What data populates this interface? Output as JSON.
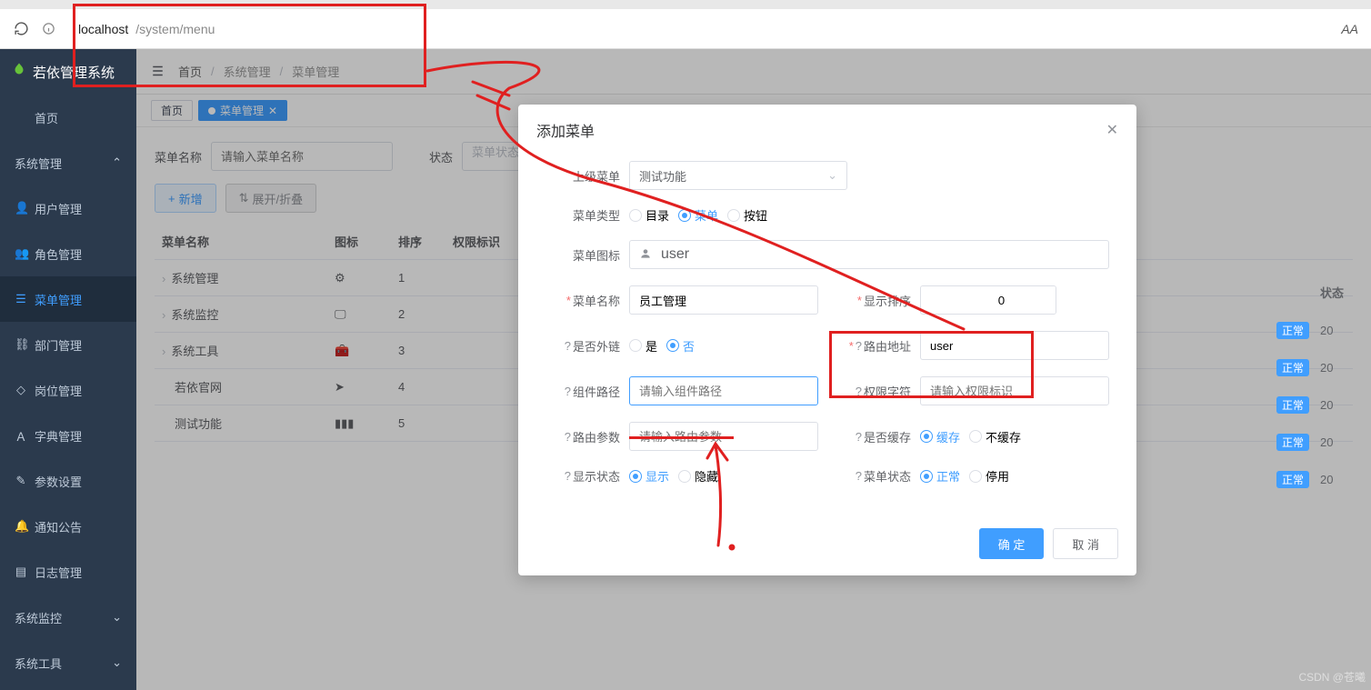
{
  "browser": {
    "tabs": [
      "若依管理系统",
      "若依管理系统"
    ],
    "url_origin": "localhost",
    "url_path": "/system/menu",
    "reader_label": "AA"
  },
  "app_title": "若依管理系统",
  "breadcrumbs": {
    "home": "首页",
    "sys": "系统管理",
    "menu": "菜单管理"
  },
  "tabs": {
    "home": "首页",
    "active": "菜单管理"
  },
  "sidebar": {
    "group_system": "系统管理",
    "group_monitor": "系统监控",
    "group_tool": "系统工具",
    "home": "首页",
    "items": [
      "用户管理",
      "角色管理",
      "菜单管理",
      "部门管理",
      "岗位管理",
      "字典管理",
      "参数设置",
      "通知公告",
      "日志管理"
    ]
  },
  "filter": {
    "name_label": "菜单名称",
    "name_placeholder": "请输入菜单名称",
    "status_label": "状态",
    "status_placeholder": "菜单状态"
  },
  "buttons": {
    "add": "新增",
    "expand": "展开/折叠"
  },
  "table": {
    "headers": [
      "菜单名称",
      "图标",
      "排序",
      "权限标识",
      "状态"
    ],
    "rows": [
      {
        "name": "系统管理",
        "order": "1",
        "status": "正常",
        "year": "20"
      },
      {
        "name": "系统监控",
        "order": "2",
        "status": "正常",
        "year": "20"
      },
      {
        "name": "系统工具",
        "order": "3",
        "status": "正常",
        "year": "20"
      },
      {
        "name": "若依官网",
        "order": "4",
        "status": "正常",
        "year": "20"
      },
      {
        "name": "测试功能",
        "order": "5",
        "status": "正常",
        "year": "20"
      }
    ]
  },
  "dialog": {
    "title": "添加菜单",
    "parent_label": "上级菜单",
    "parent_value": "测试功能",
    "type_label": "菜单类型",
    "type_options": [
      "目录",
      "菜单",
      "按钮"
    ],
    "type_selected": "菜单",
    "icon_label": "菜单图标",
    "icon_value": "user",
    "name_label": "菜单名称",
    "name_value": "员工管理",
    "order_label": "显示排序",
    "order_value": "0",
    "external_label": "是否外链",
    "external_options": [
      "是",
      "否"
    ],
    "external_selected": "否",
    "route_label": "路由地址",
    "route_value": "user",
    "component_label": "组件路径",
    "component_placeholder": "请输入组件路径",
    "perm_label": "权限字符",
    "perm_placeholder": "请输入权限标识",
    "params_label": "路由参数",
    "params_placeholder": "请输入路由参数",
    "cache_label": "是否缓存",
    "cache_options": [
      "缓存",
      "不缓存"
    ],
    "cache_selected": "缓存",
    "display_label": "显示状态",
    "display_options": [
      "显示",
      "隐藏"
    ],
    "display_selected": "显示",
    "status_label": "菜单状态",
    "status_options": [
      "正常",
      "停用"
    ],
    "status_selected": "正常",
    "ok": "确 定",
    "cancel": "取 消"
  },
  "watermark": "CSDN @苍曦"
}
